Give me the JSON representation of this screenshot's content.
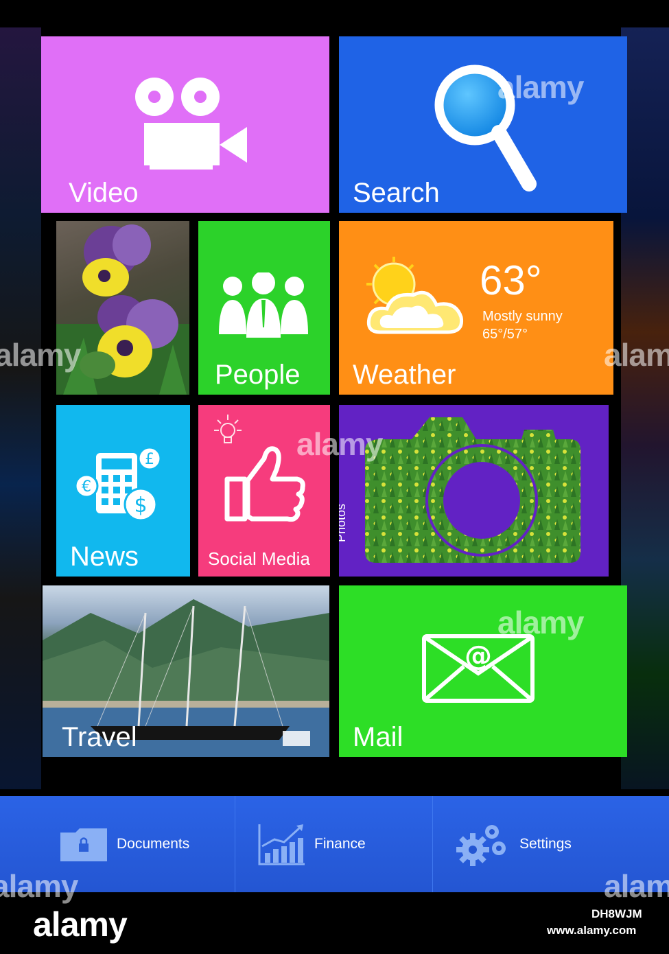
{
  "tiles": {
    "video": {
      "label": "Video",
      "color": "#e06ff7"
    },
    "search": {
      "label": "Search",
      "color": "#1f63e6"
    },
    "people": {
      "label": "People",
      "color": "#2cd22a"
    },
    "weather": {
      "label": "Weather",
      "temperature": "63°",
      "condition": "Mostly sunny",
      "range": "65°/57°",
      "color": "#ff8f15"
    },
    "news": {
      "label": "News",
      "color": "#11b8ee"
    },
    "social": {
      "label": "Social Media",
      "color": "#f63c7d"
    },
    "photos": {
      "label": "Photos",
      "color": "#6222c4"
    },
    "travel": {
      "label": "Travel"
    },
    "mail": {
      "label": "Mail",
      "color": "#2dde26"
    }
  },
  "dock": {
    "items": [
      {
        "label": "Documents",
        "icon": "folder-lock-icon"
      },
      {
        "label": "Finance",
        "icon": "chart-icon"
      },
      {
        "label": "Settings",
        "icon": "gears-icon"
      }
    ]
  },
  "watermark": {
    "overlay_text": "alamy",
    "brand": "alamy",
    "image_code": "DH8WJM",
    "url": "www.alamy.com"
  }
}
